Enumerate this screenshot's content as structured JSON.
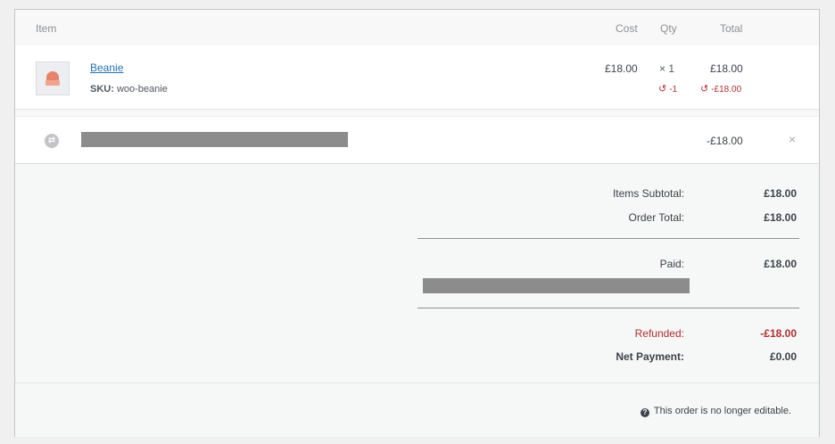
{
  "header": {
    "item": "Item",
    "cost": "Cost",
    "qty": "Qty",
    "total": "Total"
  },
  "line_item": {
    "name": "Beanie",
    "sku_label": "SKU:",
    "sku_value": "woo-beanie",
    "cost": "£18.00",
    "qty": "× 1",
    "total": "£18.00",
    "refund_qty": "-1",
    "refund_total": "-£18.00",
    "thumbnail_icon": "beanie-thumbnail"
  },
  "refund_line": {
    "amount": "-£18.00",
    "icon": "refund-icon",
    "remove": "×"
  },
  "totals": {
    "items_subtotal_label": "Items Subtotal:",
    "items_subtotal_value": "£18.00",
    "order_total_label": "Order Total:",
    "order_total_value": "£18.00",
    "paid_label": "Paid:",
    "paid_value": "£18.00",
    "refunded_label": "Refunded:",
    "refunded_value": "-£18.00",
    "net_payment_label": "Net Payment:",
    "net_payment_value": "£0.00"
  },
  "footer": {
    "notice": "This order is no longer editable.",
    "help_icon": "?"
  },
  "colors": {
    "link": "#2271b1",
    "refund": "#b32d2e",
    "redacted": "#8c8c8c"
  }
}
